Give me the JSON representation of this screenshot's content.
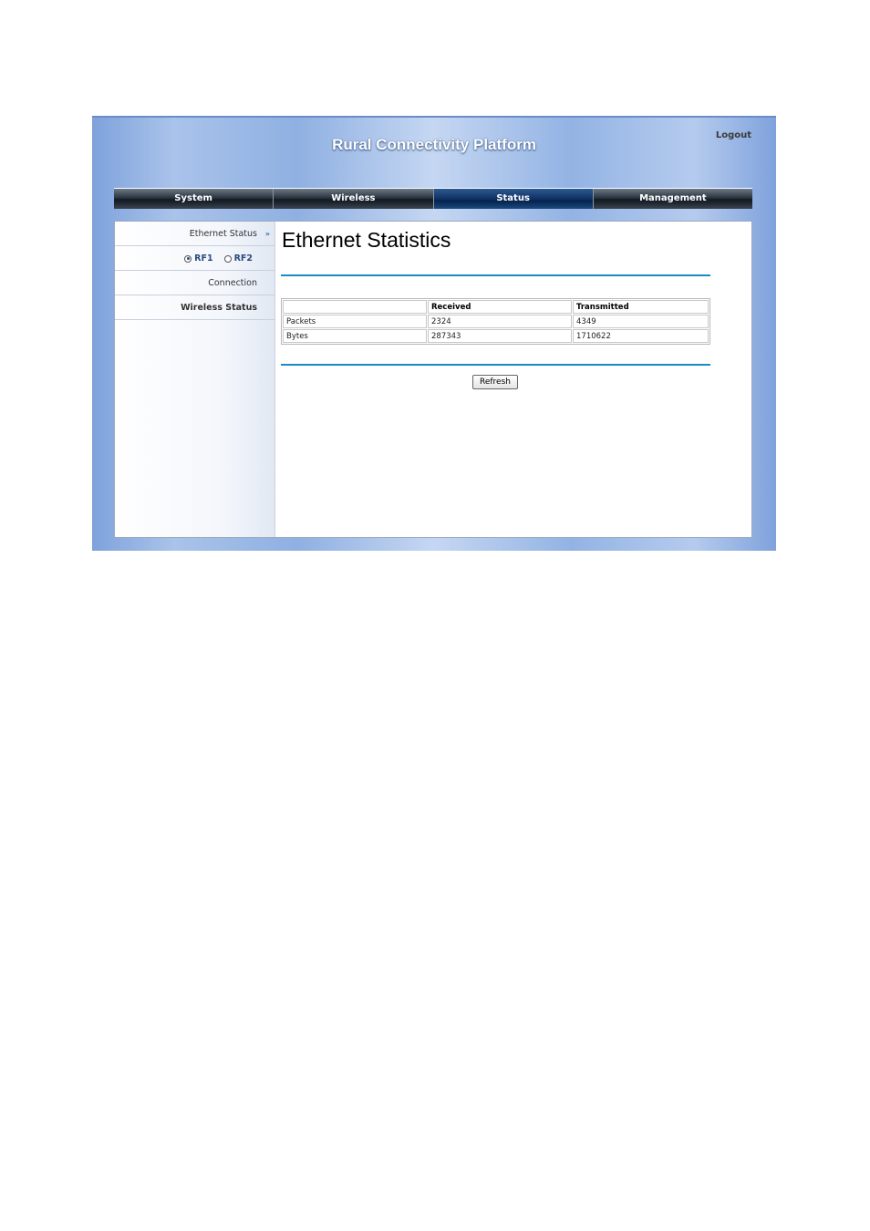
{
  "header": {
    "title": "Rural Connectivity Platform",
    "logout_label": "Logout"
  },
  "nav": {
    "items": [
      {
        "label": "System"
      },
      {
        "label": "Wireless"
      },
      {
        "label": "Status",
        "active": true
      },
      {
        "label": "Management"
      }
    ]
  },
  "sidebar": {
    "ethernet_status": "Ethernet Status",
    "arrow": "»",
    "radio": {
      "rf1": "RF1",
      "rf2": "RF2",
      "selected": "RF1"
    },
    "connection": "Connection",
    "wireless_status": "Wireless Status"
  },
  "main": {
    "title": "Ethernet Statistics",
    "table": {
      "columns": [
        "",
        "Received",
        "Transmitted"
      ],
      "rows": [
        {
          "label": "Packets",
          "received": "2324",
          "transmitted": "4349"
        },
        {
          "label": "Bytes",
          "received": "287343",
          "transmitted": "1710622"
        }
      ]
    },
    "refresh_label": "Refresh"
  },
  "colors": {
    "accent_rule": "#1b8ac7",
    "nav_active": "#0e3164",
    "banner": "#a9c3ea"
  }
}
